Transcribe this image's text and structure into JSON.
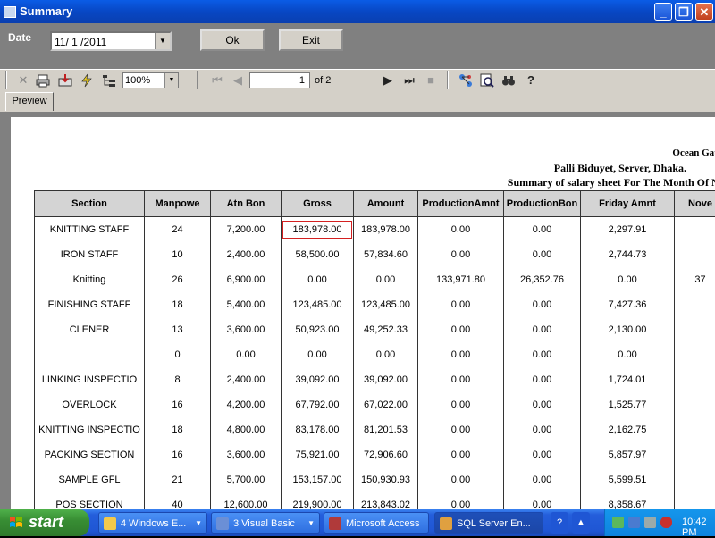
{
  "window": {
    "title": "Summary",
    "controls": {
      "minimize": "_",
      "restore": "❐",
      "close": "✕"
    }
  },
  "form": {
    "date_label": "Date",
    "date_value": "11/ 1 /2011",
    "ok_label": "Ok",
    "exit_label": "Exit"
  },
  "toolbar": {
    "zoom_value": "100%",
    "page_current": "1",
    "page_total_text": "of 2",
    "icons": [
      "close-icon",
      "print-icon",
      "export-icon",
      "refresh-icon",
      "group-tree-icon",
      "first-page-icon",
      "prev-page-icon",
      "next-page-icon",
      "last-page-icon",
      "stop-icon",
      "connect-icon",
      "zoom-icon",
      "search-icon",
      "help-icon"
    ]
  },
  "tabs": {
    "preview_label": "Preview"
  },
  "report": {
    "company": "Ocean Gate Sweater Ltd",
    "address": "Palli Biduyet, Server, Dhaka.",
    "subtitle": "Summary of salary sheet For The Month Of Novem",
    "headers": [
      "Section",
      "Manpowe",
      "Atn Bon",
      "Gross",
      "Amount",
      "ProductionAmnt",
      "ProductionBon",
      "Friday Amnt",
      "Nove"
    ],
    "rows": [
      [
        "KNITTING STAFF",
        "24",
        "7,200.00",
        "183,978.00",
        "183,978.00",
        "0.00",
        "0.00",
        "2,297.91",
        ""
      ],
      [
        "IRON STAFF",
        "10",
        "2,400.00",
        "58,500.00",
        "57,834.60",
        "0.00",
        "0.00",
        "2,744.73",
        ""
      ],
      [
        "Knitting",
        "26",
        "6,900.00",
        "0.00",
        "0.00",
        "133,971.80",
        "26,352.76",
        "0.00",
        "37"
      ],
      [
        "FINISHING STAFF",
        "18",
        "5,400.00",
        "123,485.00",
        "123,485.00",
        "0.00",
        "0.00",
        "7,427.36",
        ""
      ],
      [
        "CLENER",
        "13",
        "3,600.00",
        "50,923.00",
        "49,252.33",
        "0.00",
        "0.00",
        "2,130.00",
        ""
      ],
      [
        "",
        "0",
        "0.00",
        "0.00",
        "0.00",
        "0.00",
        "0.00",
        "0.00",
        ""
      ],
      [
        "LINKING INSPECTIO",
        "8",
        "2,400.00",
        "39,092.00",
        "39,092.00",
        "0.00",
        "0.00",
        "1,724.01",
        ""
      ],
      [
        "OVERLOCK",
        "16",
        "4,200.00",
        "67,792.00",
        "67,022.00",
        "0.00",
        "0.00",
        "1,525.77",
        ""
      ],
      [
        "KNITTING INSPECTIO",
        "18",
        "4,800.00",
        "83,178.00",
        "81,201.53",
        "0.00",
        "0.00",
        "2,162.75",
        ""
      ],
      [
        "PACKING SECTION",
        "16",
        "3,600.00",
        "75,921.00",
        "72,906.60",
        "0.00",
        "0.00",
        "5,857.97",
        ""
      ],
      [
        "SAMPLE GFL",
        "21",
        "5,700.00",
        "153,157.00",
        "150,930.93",
        "0.00",
        "0.00",
        "5,599.51",
        ""
      ],
      [
        "POS SECTION",
        "40",
        "12,600.00",
        "219,900.00",
        "213,843.02",
        "0.00",
        "0.00",
        "8,358.67",
        ""
      ]
    ]
  },
  "taskbar": {
    "start_label": "start",
    "tasks": [
      {
        "label": "4 Windows E...",
        "icon": "folder-icon",
        "color": "#f2c94c"
      },
      {
        "label": "3 Visual Basic",
        "icon": "vb-icon",
        "color": "#6b8fd6"
      },
      {
        "label": "Microsoft Access",
        "icon": "access-icon",
        "color": "#b03a3a"
      },
      {
        "label": "SQL Server En...",
        "icon": "sql-icon",
        "color": "#e0a040"
      }
    ],
    "clock": "10:42 PM"
  }
}
